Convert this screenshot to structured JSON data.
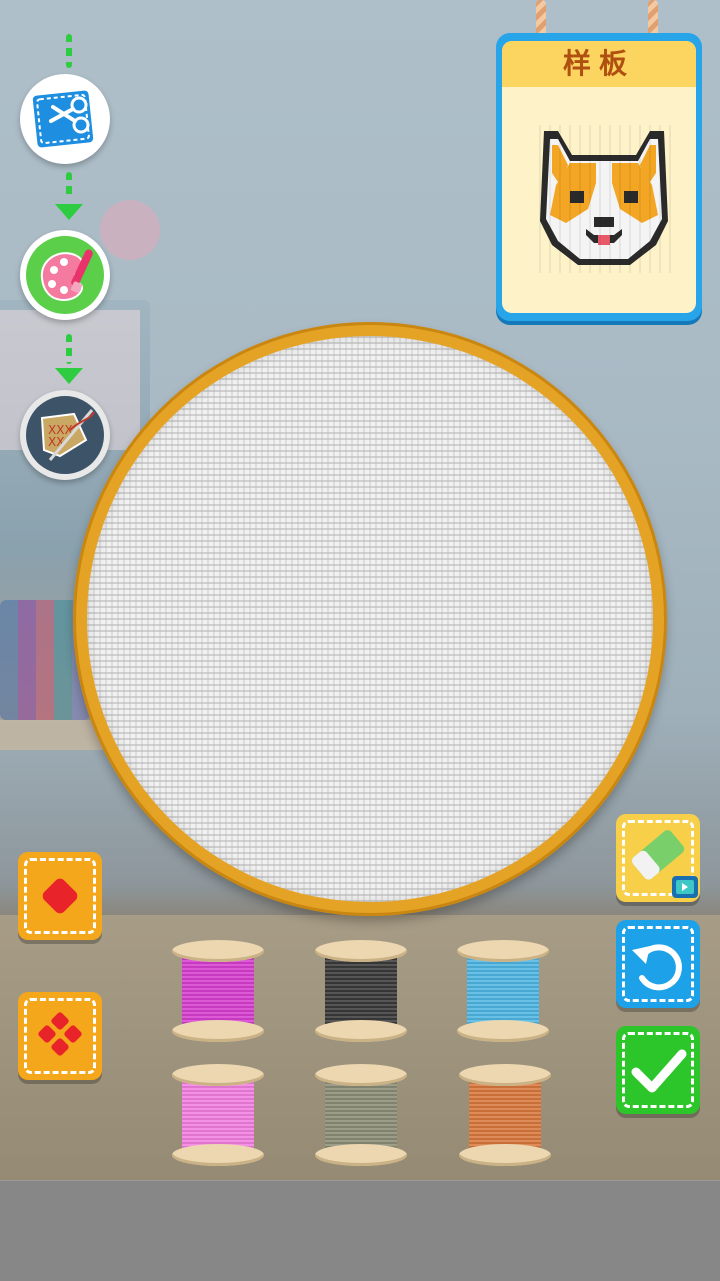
{
  "sample_card": {
    "title": "样板"
  },
  "steps": [
    {
      "name": "cut-fabric",
      "icon": "scissors-fabric-icon",
      "state": "completed"
    },
    {
      "name": "color-palette",
      "icon": "palette-icon",
      "state": "completed"
    },
    {
      "name": "cross-stitch",
      "icon": "needle-thread-icon",
      "state": "current"
    }
  ],
  "threads": [
    {
      "color_name": "magenta",
      "color": "#d63fcf"
    },
    {
      "color_name": "black",
      "color": "#3a3a3a"
    },
    {
      "color_name": "sky-blue",
      "color": "#4fb6e3"
    },
    {
      "color_name": "pink",
      "color": "#f27fe0"
    },
    {
      "color_name": "olive-grey",
      "color": "#8c8d76"
    },
    {
      "color_name": "orange",
      "color": "#d9783e"
    }
  ],
  "tools": {
    "left": [
      "single-stitch-icon",
      "cluster-stitch-icon"
    ],
    "right": [
      "eraser-video-icon",
      "undo-icon",
      "confirm-check-icon"
    ]
  },
  "colors": {
    "accent_blue": "#1da1e8",
    "accent_green": "#2cc62a",
    "hoop": "#e5a325",
    "tool_orange": "#f5a71b"
  }
}
